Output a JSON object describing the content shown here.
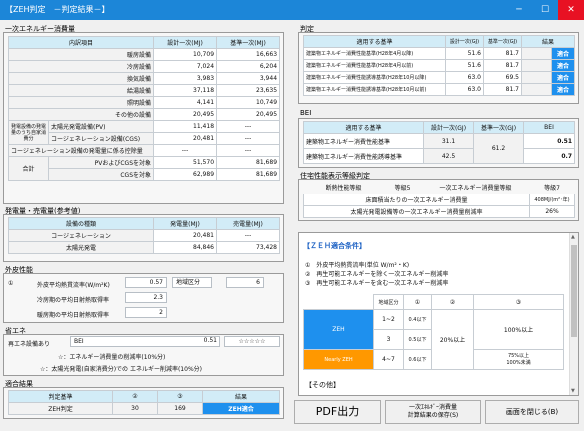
{
  "window": {
    "title": "【ZEH判定　－判定結果－】",
    "min": "─",
    "max": "☐",
    "close": "✕"
  },
  "primary": {
    "section": "一次エネルギー消費量",
    "headers": [
      "内訳項目",
      "設計一次(MJ)",
      "基準一次(MJ)"
    ],
    "rows": [
      [
        "暖房設備",
        "10,709",
        "16,663"
      ],
      [
        "冷房設備",
        "7,024",
        "6,204"
      ],
      [
        "換気設備",
        "3,983",
        "3,944"
      ],
      [
        "給湯設備",
        "37,118",
        "23,635"
      ],
      [
        "照明設備",
        "4,141",
        "10,749"
      ],
      [
        "その他の設備",
        "20,495",
        "20,495"
      ]
    ],
    "gen_group": "発電設備の発電量のうち自家消費分",
    "gen_rows": [
      [
        "太陽光発電設備(PV)",
        "11,418",
        "---"
      ],
      [
        "コージェネレーション設備(CGS)",
        "20,481",
        "---"
      ]
    ],
    "cgs_row": [
      "コージェネレーション設備の発電量に係る控除量",
      "---",
      "---"
    ],
    "total_label": "合計",
    "total_rows": [
      [
        "PVおよびCGSを対象",
        "51,570",
        "81,689"
      ],
      [
        "CGSを対象",
        "62,989",
        "81,689"
      ]
    ]
  },
  "gen": {
    "section": "発電量・売電量(参考値)",
    "headers": [
      "設備の種類",
      "発電量(MJ)",
      "売電量(MJ)"
    ],
    "rows": [
      [
        "コージェネレーション",
        "20,481",
        "---"
      ],
      [
        "太陽光発電",
        "84,846",
        "73,428"
      ]
    ]
  },
  "envelope": {
    "section": "外皮性能",
    "circle": "①",
    "ua_label": "外皮平均熱貫流率(W/m²K)",
    "ua": "0.57",
    "region_label": "地域区分",
    "region": "6",
    "etac_label": "冷房期の平均日射熱取得率",
    "etac": "2.3",
    "etah_label": "暖房期の平均日射熱取得率",
    "etah": "2"
  },
  "saving": {
    "section": "省エネ",
    "label": "再エネ設備あり",
    "bei_label": "BEI",
    "bei": "0.51",
    "stars": "☆☆☆☆☆",
    "note1": "☆：エネルギー消費量の削減率(10%分)",
    "note2": "☆：太陽光発電(自家消費分)での エネルギー削減率(10%分)"
  },
  "result": {
    "section": "適合結果",
    "headers": [
      "判定基準",
      "②",
      "③",
      "結果"
    ],
    "row": [
      "ZEH判定",
      "30",
      "169",
      "ZEH適合"
    ]
  },
  "judge": {
    "section": "判定",
    "headers": [
      "適用する基準",
      "設計一次(GJ)",
      "基準一次(GJ)",
      "結果"
    ],
    "rows": [
      [
        "建築物エネルギー消費性能基準(H28年4月以降)",
        "51.6",
        "81.7",
        "適合"
      ],
      [
        "建築物エネルギー消費性能基準(H28年4月以前)",
        "51.6",
        "81.7",
        "適合"
      ],
      [
        "建築物エネルギー消費性能誘導基準(H28年10月以降)",
        "63.0",
        "69.5",
        "適合"
      ],
      [
        "建築物エネルギー消費性能誘導基準(H28年10月以前)",
        "63.0",
        "81.7",
        "適合"
      ]
    ]
  },
  "bei": {
    "section": "BEI",
    "headers": [
      "適用する基準",
      "設計一次(GJ)",
      "基準一次(GJ)",
      "BEI"
    ],
    "rows": [
      [
        "建築物エネルギー消費性能基準",
        "31.1",
        "0.51"
      ],
      [
        "建築物エネルギー消費性能誘導基準",
        "42.5",
        "0.7"
      ]
    ],
    "shared": "61.2"
  },
  "label": {
    "section": "住宅性能表示等級判定",
    "c1": "断熱性能等級",
    "c2": "等級5",
    "c3": "一次エネルギー消費量等級",
    "c4": "等級7",
    "r1": "床面積当たりの一次エネルギー消費量",
    "r1v": "408MJ/(m²･年)",
    "r2": "太陽光発電設備等の一次エネルギー消費量削減率",
    "r2v": "26%"
  },
  "zeh": {
    "title": "【ＺＥＨ適合条件】",
    "c1": "①　外皮平均熱貫流率(単位 W/m²・K)",
    "c2": "②　再生可能エネルギーを除く一次エネルギー削減率",
    "c3": "③　再生可能エネルギーを含む一次エネルギー削減率",
    "headers": [
      "地域区分",
      "①",
      "②",
      "③"
    ],
    "zeh_label": "ZEH",
    "nearly_label": "Nearly ZEH",
    "r1": [
      "1~2",
      "0.4以下"
    ],
    "r2": [
      "3",
      "0.5以下"
    ],
    "r3": [
      "4~7",
      "0.6以下"
    ],
    "v2": "20%以上",
    "v3a": "100%以上",
    "v3b": "75%以上\n100%未満",
    "other": "【その他】"
  },
  "buttons": {
    "pdf": "PDF出力",
    "save": "一次ｴﾈﾙｷﾞｰ消費量\n計算結果の保存(S)",
    "close": "画面を閉じる(B)"
  }
}
